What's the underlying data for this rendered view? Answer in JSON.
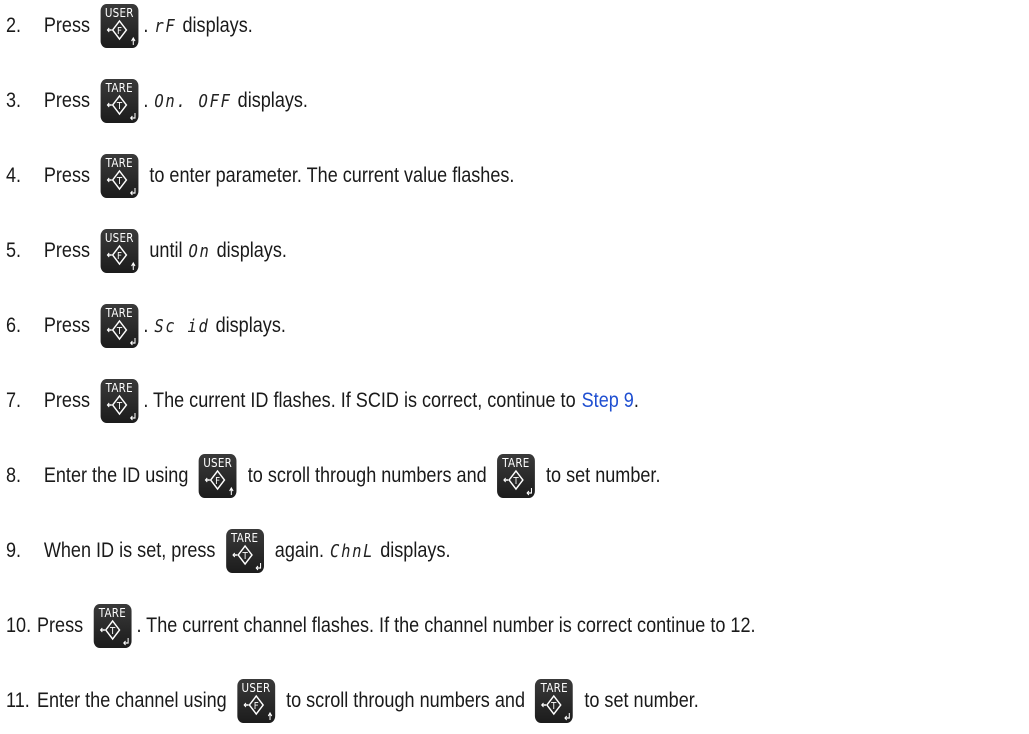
{
  "keys": {
    "user_label": "USER",
    "tare_label": "TARE"
  },
  "steps": [
    {
      "num": "2.",
      "a": "Press",
      "key": "user",
      "b": ".",
      "disp": "rF",
      "c": "displays."
    },
    {
      "num": "3.",
      "a": "Press",
      "key": "tare",
      "b": ".",
      "disp": "On. OFF",
      "c": "displays."
    },
    {
      "num": "4.",
      "a": "Press",
      "key": "tare",
      "b": "to enter parameter. The current value flashes."
    },
    {
      "num": "5.",
      "a": "Press",
      "key": "user",
      "b": "until",
      "disp": "On",
      "c": "displays."
    },
    {
      "num": "6.",
      "a": "Press",
      "key": "tare",
      "b": ".",
      "disp": "Sc id",
      "c": "displays."
    },
    {
      "num": "7.",
      "a": "Press",
      "key": "tare",
      "b": ". The current ID flashes. If SCID is correct, continue to",
      "link": "Step 9",
      "d": "."
    },
    {
      "num": "8.",
      "a": "Enter the ID using",
      "key": "user",
      "b": "to scroll through numbers and",
      "key2": "tare",
      "e": "to set number."
    },
    {
      "num": "9.",
      "a": "When ID is set, press",
      "key": "tare",
      "b": "again.",
      "disp": "ChnL",
      "c": "displays."
    },
    {
      "num": "10.",
      "a": "Press",
      "key": "tare",
      "b": ". The current channel flashes. If the channel number is correct continue to 12."
    },
    {
      "num": "11.",
      "a": "Enter the channel using",
      "key": "user",
      "b": "to scroll through numbers and",
      "key2": "tare",
      "e": "to set number."
    }
  ]
}
